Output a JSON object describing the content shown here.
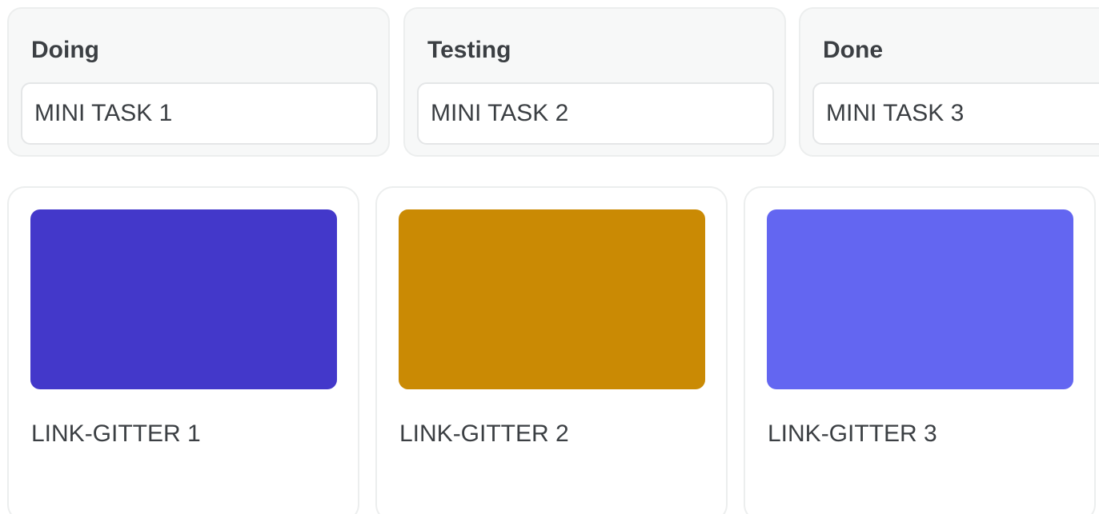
{
  "columns": [
    {
      "title": "Doing",
      "task": "MINI TASK 1"
    },
    {
      "title": "Testing",
      "task": "MINI TASK 2"
    },
    {
      "title": "Done",
      "task": "MINI TASK 3"
    }
  ],
  "links": [
    {
      "label": "LINK-GITTER 1",
      "color": "#4338ca"
    },
    {
      "label": "LINK-GITTER 2",
      "color": "#ca8a04"
    },
    {
      "label": "LINK-GITTER 3",
      "color": "#6366f1"
    }
  ]
}
